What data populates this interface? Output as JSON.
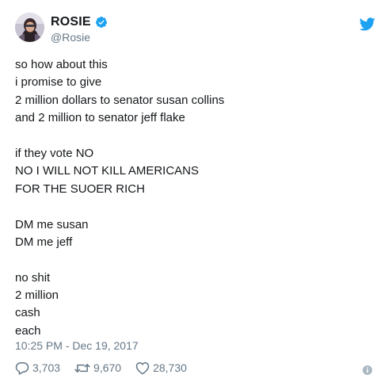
{
  "author": {
    "display_name": "ROSIE",
    "handle": "@Rosie",
    "verified": true,
    "avatar_icon": "profile-photo"
  },
  "brand": {
    "logo_icon": "twitter-bird-icon",
    "accent_color": "#1da1f2"
  },
  "tweet": {
    "lines": [
      "so how about this",
      "i promise to give",
      "2 million dollars to senator susan collins",
      "and 2 million to senator jeff flake",
      "",
      "if they vote NO",
      "NO I WILL NOT KILL AMERICANS",
      "FOR THE SUOER RICH",
      "",
      "DM me susan",
      "DM me jeff",
      "",
      "no shit",
      "2 million",
      "cash",
      "each"
    ],
    "timestamp": "10:25 PM - Dec 19, 2017"
  },
  "actions": {
    "reply_count": "3,703",
    "retweet_count": "9,670",
    "like_count": "28,730"
  },
  "colors": {
    "text": "#14171a",
    "secondary_text": "#657786",
    "verified_blue": "#1da1f2"
  }
}
